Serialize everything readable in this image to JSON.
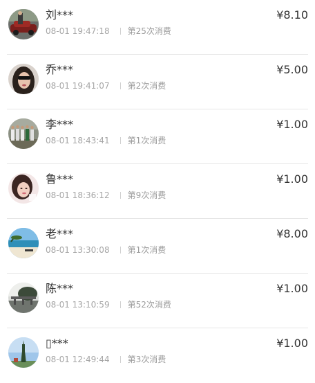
{
  "records": [
    {
      "name": "刘***",
      "time": "08-01 19:47:18",
      "count": "第25次消费",
      "amount": "¥8.10",
      "avatar_icon": "car-photo-icon"
    },
    {
      "name": "乔***",
      "time": "08-01 19:41:07",
      "count": "第2次消费",
      "amount": "¥5.00",
      "avatar_icon": "woman-sunglasses-photo-icon"
    },
    {
      "name": "李***",
      "time": "08-01 18:43:41",
      "count": "第1次消费",
      "amount": "¥1.00",
      "avatar_icon": "group-photo-icon"
    },
    {
      "name": "鲁***",
      "time": "08-01 18:36:12",
      "count": "第9次消费",
      "amount": "¥1.00",
      "avatar_icon": "girl-portrait-icon"
    },
    {
      "name": "老***",
      "time": "08-01 13:30:08",
      "count": "第1次消费",
      "amount": "¥8.00",
      "avatar_icon": "beach-photo-icon"
    },
    {
      "name": "陈***",
      "time": "08-01 13:10:59",
      "count": "第52次消费",
      "amount": "¥1.00",
      "avatar_icon": "bridge-photo-icon"
    },
    {
      "name": "▯***",
      "time": "08-01 12:49:44",
      "count": "第3次消费",
      "amount": "¥1.00",
      "avatar_icon": "tower-photo-icon"
    }
  ]
}
